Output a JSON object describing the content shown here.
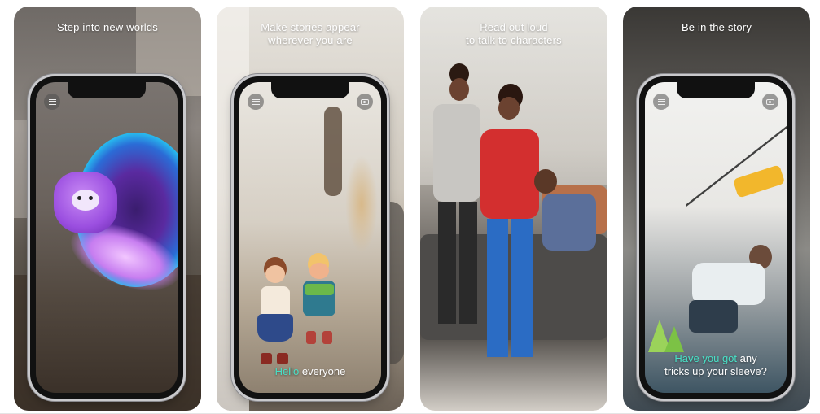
{
  "screens": [
    {
      "title": "Step into new worlds",
      "caption_highlight": "",
      "caption_rest": ""
    },
    {
      "title": "Make stories appear\nwherever you are",
      "caption_highlight": "Hello",
      "caption_rest": " everyone"
    },
    {
      "title": "Read out loud\nto talk to characters",
      "caption_highlight": "",
      "caption_rest": ""
    },
    {
      "title": "Be in the story",
      "caption_highlight": "Have you got",
      "caption_rest": " any\ntricks up your sleeve?"
    }
  ],
  "colors": {
    "highlight": "#49e0c6"
  },
  "icons": {
    "menu": "menu-icon",
    "camera": "camera-icon"
  }
}
